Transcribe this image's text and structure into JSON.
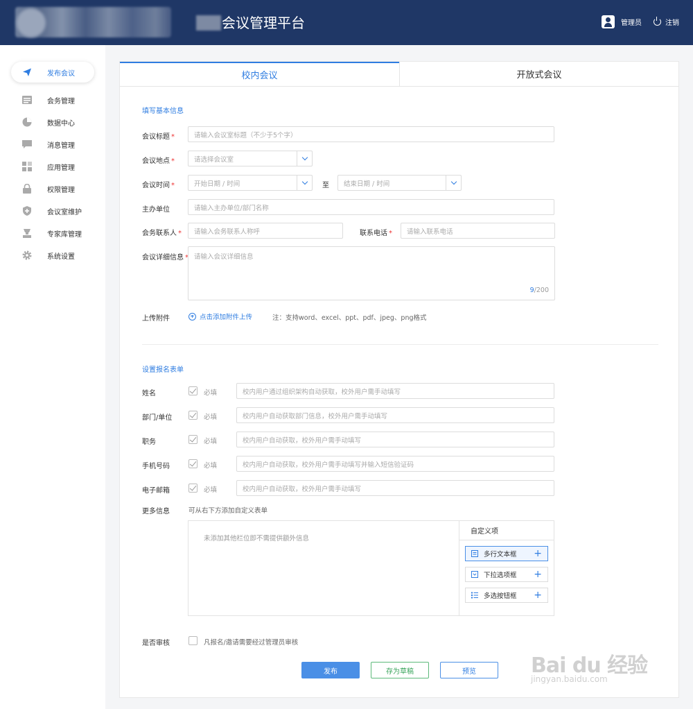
{
  "header": {
    "app_title": "会议管理平台",
    "user_label": "管理员",
    "logout_label": "注销"
  },
  "sidebar": {
    "items": [
      {
        "label": "发布会议",
        "icon": "send-icon"
      },
      {
        "label": "会务管理",
        "icon": "list-icon"
      },
      {
        "label": "数据中心",
        "icon": "pie-chart-icon"
      },
      {
        "label": "消息管理",
        "icon": "message-icon"
      },
      {
        "label": "应用管理",
        "icon": "apps-grid-icon"
      },
      {
        "label": "权限管理",
        "icon": "lock-icon"
      },
      {
        "label": "会议室维护",
        "icon": "shield-plus-icon"
      },
      {
        "label": "专家库管理",
        "icon": "expert-icon"
      },
      {
        "label": "系统设置",
        "icon": "gear-icon"
      }
    ]
  },
  "tabs": {
    "internal": "校内会议",
    "open": "开放式会议"
  },
  "basic": {
    "section_title": "填写基本信息",
    "title_label": "会议标题",
    "title_placeholder": "请输入会议室标题（不少于5个字）",
    "location_label": "会议地点",
    "location_placeholder": "请选择会议室",
    "time_label": "会议时间",
    "start_placeholder": "开始日期 / 时间",
    "to_label": "至",
    "end_placeholder": "结束日期 / 时间",
    "host_label": "主办单位",
    "host_placeholder": "请输入主办单位/部门名称",
    "contact_label": "会务联系人",
    "contact_placeholder": "请输入会务联系人称呼",
    "phone_label": "联系电话",
    "phone_placeholder": "请输入联系电话",
    "detail_label": "会议详细信息",
    "detail_placeholder": "请输入会议详细信息",
    "counter_current": "9",
    "counter_max": "/200",
    "attach_label": "上传附件",
    "attach_link": "点击添加附件上传",
    "attach_note": "注：支持word、excel、ppt、pdf、jpeg、png格式"
  },
  "form": {
    "section_title": "设置报名表单",
    "required_text": "必填",
    "fields": [
      {
        "label": "姓名",
        "hint": "校内用户通过组织架构自动获取，校外用户需手动填写"
      },
      {
        "label": "部门/单位",
        "hint": "校内用户自动获取部门信息，校外用户需手动填写"
      },
      {
        "label": "职务",
        "hint": "校内用户自动获取，校外用户需手动填写"
      },
      {
        "label": "手机号码",
        "hint": "校内用户自动获取，校外用户需手动填写并输入短信验证码"
      },
      {
        "label": "电子邮箱",
        "hint": "校内用户自动获取，校外用户需手动填写"
      }
    ],
    "more_label": "更多信息",
    "more_hint": "可从右下方添加自定义表单",
    "empty_text": "未添加其他栏位即不需提供额外信息",
    "custom_title": "自定义项",
    "custom_items": [
      {
        "label": "多行文本框",
        "icon": "textarea-icon"
      },
      {
        "label": "下拉选项框",
        "icon": "dropdown-icon"
      },
      {
        "label": "多选按钮框",
        "icon": "checklist-icon"
      }
    ],
    "review_label": "是否审核",
    "review_text": "凡报名/邀请需要经过管理员审核"
  },
  "actions": {
    "publish": "发布",
    "draft": "存为草稿",
    "preview": "预览"
  },
  "watermark": {
    "brand": "Bai du 经验",
    "url": "jingyan.baidu.com"
  },
  "colors": {
    "header_bg": "#1f3766",
    "accent": "#2f7de1",
    "required": "#ee3333",
    "draft_green": "#3aa55c"
  }
}
